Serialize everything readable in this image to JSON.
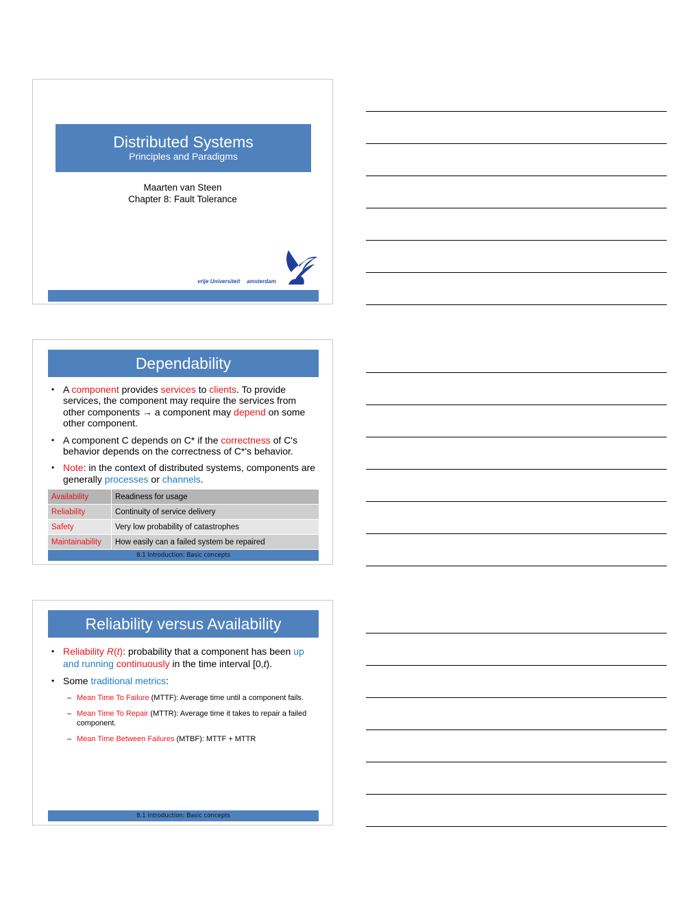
{
  "slides": [
    {
      "title": "Distributed Systems",
      "subtitle": "Principles and Paradigms",
      "author": "Maarten van Steen",
      "chapter": "Chapter 8: Fault Tolerance",
      "logo": {
        "text_left": "vrije Universiteit",
        "text_right": "amsterdam",
        "icon": "griffin-logo-icon"
      }
    },
    {
      "title": "Dependability",
      "bullets": [
        {
          "segments": [
            {
              "t": "A ",
              "c": ""
            },
            {
              "t": "component",
              "c": "red"
            },
            {
              "t": " provides ",
              "c": ""
            },
            {
              "t": "services",
              "c": "red"
            },
            {
              "t": " to ",
              "c": ""
            },
            {
              "t": "clients",
              "c": "red"
            },
            {
              "t": ". To provide services, the component may require the services from other components → a component may ",
              "c": ""
            },
            {
              "t": "depend",
              "c": "red"
            },
            {
              "t": " on some other component.",
              "c": ""
            }
          ]
        },
        {
          "segments": [
            {
              "t": "A component C depends on C* if the ",
              "c": ""
            },
            {
              "t": "correctness",
              "c": "red"
            },
            {
              "t": " of C's behavior depends on the correctness of C*'s behavior.",
              "c": ""
            }
          ]
        },
        {
          "segments": [
            {
              "t": "Note",
              "c": "red"
            },
            {
              "t": ": in the context of distributed systems, components are generally ",
              "c": ""
            },
            {
              "t": "processes",
              "c": "blue"
            },
            {
              "t": " or ",
              "c": ""
            },
            {
              "t": "channels",
              "c": "blue"
            },
            {
              "t": ".",
              "c": ""
            }
          ]
        }
      ],
      "table": [
        {
          "term": "Availability",
          "desc": "Readiness for usage",
          "bg": "#b5b5b5"
        },
        {
          "term": "Reliability",
          "desc": "Continuity of service delivery",
          "bg": "#cfcfcf"
        },
        {
          "term": "Safety",
          "desc": "Very low probability of catastrophes",
          "bg": "#e6e6e6"
        },
        {
          "term": "Maintainability",
          "desc": "How easily can a failed system be repaired",
          "bg": "#cfcfcf"
        }
      ],
      "footer": "8.1 Introduction: Basic concepts"
    },
    {
      "title": "Reliability versus Availability",
      "bullets": [
        {
          "segments": [
            {
              "t": "Reliability ",
              "c": "red"
            },
            {
              "t": "R",
              "c": "red it"
            },
            {
              "t": "(",
              "c": "red"
            },
            {
              "t": "t",
              "c": "red it"
            },
            {
              "t": ")",
              "c": "red"
            },
            {
              "t": ": probability that a component has been ",
              "c": ""
            },
            {
              "t": "up and running",
              "c": "blue"
            },
            {
              "t": " ",
              "c": ""
            },
            {
              "t": "continuously",
              "c": "red"
            },
            {
              "t": " in the time interval [0,",
              "c": ""
            },
            {
              "t": "t",
              "c": "it"
            },
            {
              "t": ").",
              "c": ""
            }
          ]
        },
        {
          "segments": [
            {
              "t": "Some ",
              "c": ""
            },
            {
              "t": "traditional metrics",
              "c": "blue"
            },
            {
              "t": ":",
              "c": ""
            }
          ]
        }
      ],
      "subbullets": [
        {
          "segments": [
            {
              "t": "Mean Time To Failure",
              "c": "red"
            },
            {
              "t": " (MTTF): Average time until a component fails.",
              "c": ""
            }
          ]
        },
        {
          "segments": [
            {
              "t": "Mean Time To Repair",
              "c": "red"
            },
            {
              "t": " (MTTR): Average time it takes to repair a failed component.",
              "c": ""
            }
          ]
        },
        {
          "segments": [
            {
              "t": "Mean Time Between Failures",
              "c": "red"
            },
            {
              "t": " (MTBF): MTTF + MTTR",
              "c": ""
            }
          ]
        }
      ],
      "footer": "8.1 Introduction: Basic concepts"
    }
  ],
  "colors": {
    "title_bar": "#4f81bd",
    "emphasis_red": "#e8141b",
    "emphasis_blue": "#1f7bc6"
  },
  "notes": {
    "lines_per_slide": 7
  }
}
